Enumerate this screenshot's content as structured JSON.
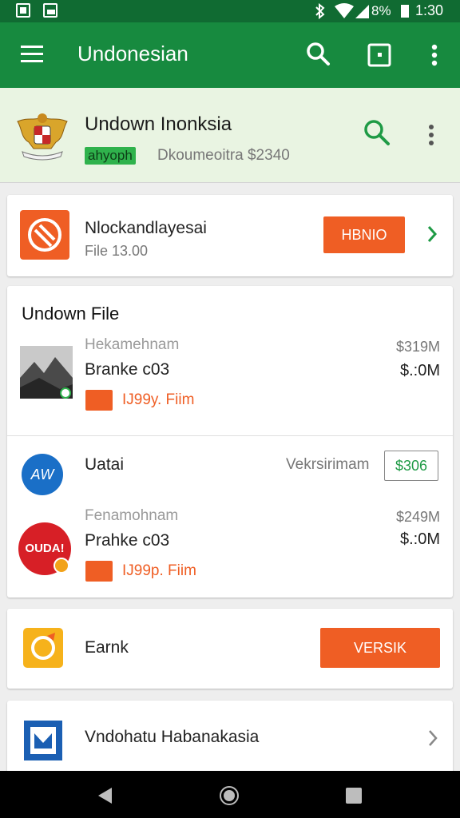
{
  "status_bar": {
    "battery": "8%",
    "time": "1:30"
  },
  "app_bar": {
    "title": "Undonesian"
  },
  "header": {
    "title": "Undown Inonksia",
    "tag": "ahyoph",
    "subtitle": "Dkoumeoitra $2340"
  },
  "promo_card": {
    "title": "Nlockandlayesai",
    "subtitle": "File 13.00",
    "button_label": "HBNIO"
  },
  "files_card": {
    "heading": "Undown File",
    "item1": {
      "line1": "Hekamehnam",
      "line2": "Branke c03",
      "tag": "IJ99y. Fiim",
      "value1": "$319M",
      "value2": "$.:0M"
    },
    "uatai": {
      "label": "Uatai",
      "right_label": "Vekrsirimam",
      "box_value": "$306",
      "logo_text": "AW"
    },
    "item2": {
      "line1": "Fenamohnam",
      "line2": "Prahke c03",
      "tag": "IJ99p. Fiim",
      "value1": "$249M",
      "value2": "$.:0M",
      "logo_text": "OUDA!"
    }
  },
  "earnk_card": {
    "label": "Earnk",
    "button_label": "VERSIK"
  },
  "link_card": {
    "label": "Vndohatu Habanakasia"
  },
  "colors": {
    "primary": "#178a3f",
    "status": "#106b32",
    "accent": "#ef5e24",
    "tag_green": "#2fb24c"
  },
  "icons": [
    "menu-icon",
    "search-icon",
    "cast-icon",
    "more-vert-icon",
    "emblem-icon",
    "chevron-right-icon",
    "back-icon",
    "home-icon",
    "recents-icon"
  ]
}
